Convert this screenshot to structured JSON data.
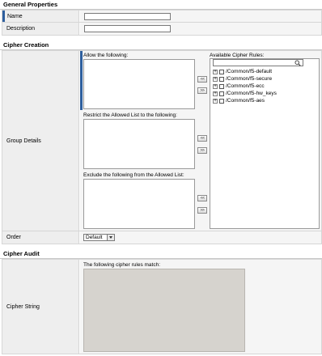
{
  "general_properties": {
    "header": "General Properties",
    "name_label": "Name",
    "name_value": "",
    "description_label": "Description",
    "description_value": ""
  },
  "cipher_creation": {
    "header": "Cipher Creation",
    "group_details_label": "Group Details",
    "allow_label": "Allow the following:",
    "restrict_label": "Restrict the Allowed List to the following:",
    "exclude_label": "Exclude the following from the Allowed List:",
    "add_button": "<<",
    "remove_button": ">>",
    "available_label": "Available Cipher Rules:",
    "search_value": "",
    "rules": [
      {
        "label": "/Common/f5-default",
        "expander": "+"
      },
      {
        "label": "/Common/f5-secure",
        "expander": "+"
      },
      {
        "label": "/Common/f5-ecc",
        "expander": "+"
      },
      {
        "label": "/Common/f5-hw_keys",
        "expander": "+"
      },
      {
        "label": "/Common/f5-aes",
        "expander": "+"
      }
    ],
    "order_label": "Order",
    "order_value": "Default"
  },
  "cipher_audit": {
    "header": "Cipher Audit",
    "cipher_string_label": "Cipher String",
    "match_label": "The following cipher rules match:"
  },
  "colors": {
    "accent": "#2e5f9e",
    "label_bg": "#eeeeee",
    "value_bg": "#f5f5f5",
    "result_bg": "#d6d3ce"
  }
}
